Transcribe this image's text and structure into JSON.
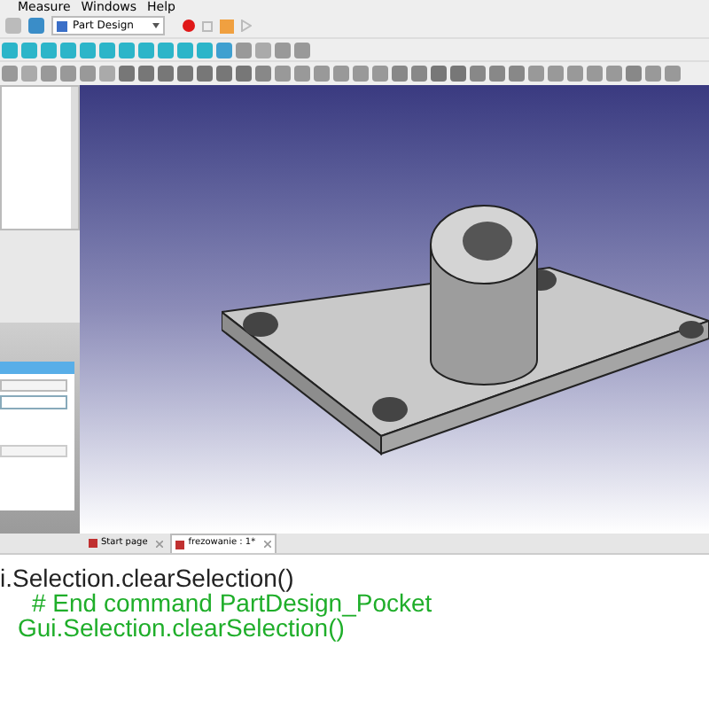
{
  "menu": [
    "Measure",
    "Windows",
    "Help"
  ],
  "workbench": {
    "label": "Part Design"
  },
  "tabs": [
    {
      "label": "Start page",
      "selected": false
    },
    {
      "label": "frezowanie : 1*",
      "selected": true
    }
  ],
  "console": [
    {
      "kind": "plain",
      "text": "i.Selection.clearSelection()"
    },
    {
      "kind": "echo",
      "text": "# End command PartDesign_Pocket"
    },
    {
      "kind": "echo",
      "text": "Gui.Selection.clearSelection()"
    }
  ]
}
